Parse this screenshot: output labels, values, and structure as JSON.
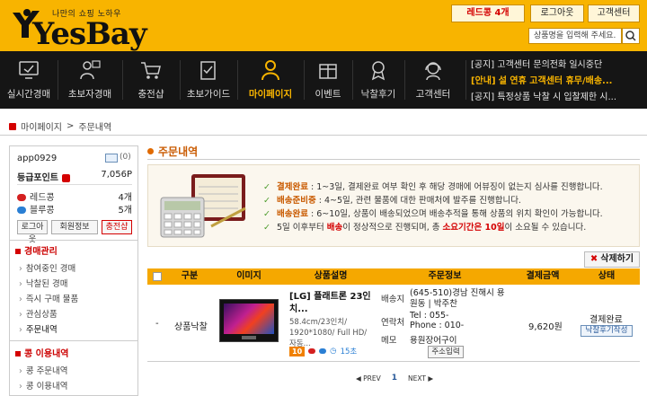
{
  "header": {
    "tagline": "나만의 쇼핑 노하우",
    "logo_text": "YesBay",
    "redcoin_label": "레드콩 4개",
    "logout_label": "로그아웃",
    "cs_label": "고객센터",
    "search_placeholder": "상품명을 입력해 주세요."
  },
  "nav": {
    "items": [
      {
        "label": "실시간경매",
        "icon": "monitor-icon"
      },
      {
        "label": "초보자경매",
        "icon": "beginner-icon"
      },
      {
        "label": "충전샵",
        "icon": "cart-icon"
      },
      {
        "label": "초보가이드",
        "icon": "checklist-icon"
      },
      {
        "label": "마이페이지",
        "icon": "person-icon",
        "active": true
      },
      {
        "label": "이벤트",
        "icon": "event-icon"
      },
      {
        "label": "낙찰후기",
        "icon": "review-icon"
      },
      {
        "label": "고객센터",
        "icon": "headset-icon"
      }
    ],
    "notices": [
      {
        "tag": "[공지]",
        "text": "고객센터 문의전화 일시중단"
      },
      {
        "tag": "[안내]",
        "text": "설 연휴 고객센터 휴무/배송..."
      },
      {
        "tag": "[공지]",
        "text": "특정상품 낙찰 시 입찰제한 시..."
      }
    ]
  },
  "breadcrumb": [
    "마이페이지",
    ">",
    "주문내역"
  ],
  "sidebar": {
    "user_id": "app0929",
    "mail_count": "(0)",
    "grade_label": "등급포인트",
    "grade_value": "7,056P",
    "red_label": "레드콩",
    "red_value": "4개",
    "blue_label": "블루콩",
    "blue_value": "5개",
    "btn_login": "로그아웃",
    "btn_member": "회원정보",
    "btn_charge": "충전샵",
    "section_auction": "경매관리",
    "auction_links": [
      "참여중인 경매",
      "낙찰된 경매",
      "즉시 구매 물품",
      "관심상품",
      "주문내역"
    ],
    "section_coin": "콩 이용내역",
    "coin_links": [
      "콩 주문내역",
      "콩 이용내역"
    ]
  },
  "main": {
    "title": "주문내역",
    "info": [
      {
        "key": "결제완료",
        "text": " : 1~3일, 결제완료 여부 확인 후 해당 경매에 어뷰징이 없는지 심사를 진행합니다."
      },
      {
        "key": "배송준비중",
        "text": " : 4~5일, 관련 물품에 대한 판매처에 발주를 진행합니다."
      },
      {
        "key": "배송완료",
        "text": " : 6~10일, 상품이 배송되었으며 배송추적을 통해 상품의 위치 확인이 가능합니다."
      },
      {
        "pre": "5일 이후부터 ",
        "hl": "배송",
        "mid": "이 정상적으로 진행되며, 총 ",
        "hl2": "소요기간은 10일",
        "post": "이 소요될 수 있습니다."
      }
    ],
    "delete_label": "삭제하기",
    "table": {
      "headers": [
        "구분",
        "이미지",
        "상품설명",
        "주문정보",
        "결제금액",
        "상태"
      ],
      "row": {
        "type": "상품낙찰",
        "product_name": "[LG] 플래트론 23인치...",
        "product_spec": "58.4cm/23인치/ 1920*1080/ Full HD/ 자동...",
        "badge": "10",
        "time": "15초",
        "order_labels": [
          "배송지",
          "연락처",
          "메모"
        ],
        "address": "(645-510)경남 진해시 용원동 | 박주찬",
        "phone": "Tel : 055-",
        "mobile": "Phone : 010-",
        "memo": "용원장어구이",
        "addr_btn": "주소입력",
        "amount": "9,620원",
        "status": "결제완료",
        "status_btn": "낙찰후기작성"
      }
    },
    "pager": {
      "prev": "◀ PREV",
      "current": "1",
      "next": "NEXT ▶"
    }
  }
}
